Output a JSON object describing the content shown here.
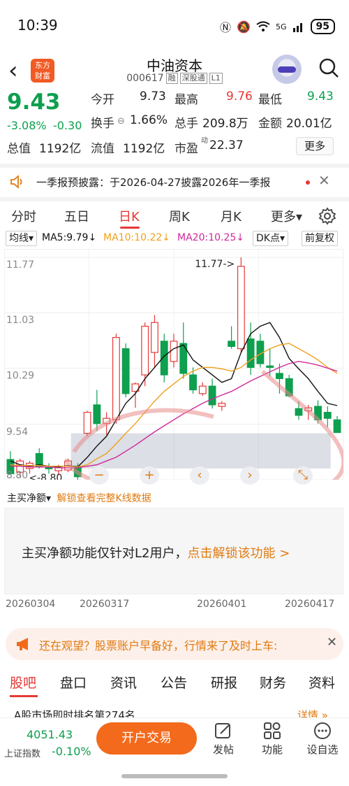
{
  "status": {
    "time": "10:39",
    "network": "5G",
    "battery": "95"
  },
  "header": {
    "logo_text_1": "东方",
    "logo_text_2": "财富",
    "stock_name": "中油资本",
    "stock_code": "000617",
    "tags": [
      "融",
      "深股通",
      "L1"
    ]
  },
  "quote": {
    "price": "9.43",
    "change_pct": "-3.08%",
    "change_abs": "-0.30",
    "open_label": "今开",
    "open_value": "9.73",
    "high_label": "最高",
    "high_value": "9.76",
    "low_label": "最低",
    "low_value": "9.43",
    "turnover_label": "换手",
    "turnover_value": "1.66%",
    "volume_label": "总手",
    "volume_value": "209.8万",
    "amount_label": "金额",
    "amount_value": "20.01亿",
    "mcap_label": "总值",
    "mcap_value": "1192亿",
    "float_label": "流值",
    "float_value": "1192亿",
    "pe_label": "市盈",
    "pe_sup": "动",
    "pe_value": "22.37",
    "more_label": "更多"
  },
  "notice": {
    "text": "一季报预披露：于2026-04-27披露2026年一季报"
  },
  "period_tabs": [
    "分时",
    "五日",
    "日K",
    "周K",
    "月K",
    "更多▾"
  ],
  "indicators": {
    "main": "均线▾",
    "ma5": "MA5:9.79↓",
    "ma10": "MA10:10.22↓",
    "ma20": "MA20:10.25↓",
    "dk": "DK点▾",
    "adjust": "前复权"
  },
  "colors": {
    "up": "#e53935",
    "down": "#0e9f4f",
    "ma5": "#111111",
    "ma10": "#f0a020",
    "ma20": "#d0289a",
    "accent": "#f36a1c"
  },
  "chart_data": {
    "type": "candlestick",
    "y_ticks": [
      "11.77",
      "11.03",
      "10.29",
      "9.54",
      "8.80"
    ],
    "ylim": [
      8.8,
      11.77
    ],
    "high_marker": "11.77->",
    "low_marker": "<-8.80",
    "x_labels": [
      "20260304",
      "20260317",
      "20260401",
      "20260417"
    ],
    "candles": [
      {
        "o": 9.07,
        "h": 9.18,
        "l": 8.86,
        "c": 8.88
      },
      {
        "o": 8.9,
        "h": 9.08,
        "l": 8.84,
        "c": 9.05
      },
      {
        "o": 8.95,
        "h": 9.05,
        "l": 8.88,
        "c": 9.02
      },
      {
        "o": 9.15,
        "h": 9.22,
        "l": 8.95,
        "c": 8.97
      },
      {
        "o": 8.96,
        "h": 9.02,
        "l": 8.88,
        "c": 8.95
      },
      {
        "o": 8.92,
        "h": 9.0,
        "l": 8.86,
        "c": 8.96
      },
      {
        "o": 8.93,
        "h": 9.08,
        "l": 8.9,
        "c": 9.05
      },
      {
        "o": 8.98,
        "h": 9.02,
        "l": 8.8,
        "c": 8.84
      },
      {
        "o": 9.42,
        "h": 9.72,
        "l": 9.38,
        "c": 9.7
      },
      {
        "o": 9.8,
        "h": 10.0,
        "l": 9.45,
        "c": 9.55
      },
      {
        "o": 9.55,
        "h": 9.7,
        "l": 9.4,
        "c": 9.62
      },
      {
        "o": 9.6,
        "h": 10.75,
        "l": 9.55,
        "c": 10.7
      },
      {
        "o": 10.55,
        "h": 10.62,
        "l": 9.9,
        "c": 9.95
      },
      {
        "o": 9.98,
        "h": 10.1,
        "l": 9.76,
        "c": 10.08
      },
      {
        "o": 10.2,
        "h": 10.9,
        "l": 10.05,
        "c": 10.85
      },
      {
        "o": 10.5,
        "h": 11.0,
        "l": 10.3,
        "c": 10.9
      },
      {
        "o": 10.65,
        "h": 10.75,
        "l": 10.1,
        "c": 10.2
      },
      {
        "o": 10.38,
        "h": 10.75,
        "l": 10.3,
        "c": 10.65
      },
      {
        "o": 10.62,
        "h": 10.9,
        "l": 10.15,
        "c": 10.22
      },
      {
        "o": 10.2,
        "h": 10.3,
        "l": 9.95,
        "c": 10.0
      },
      {
        "o": 9.95,
        "h": 10.1,
        "l": 9.92,
        "c": 10.05
      },
      {
        "o": 10.05,
        "h": 10.15,
        "l": 9.75,
        "c": 9.8
      },
      {
        "o": 9.78,
        "h": 9.85,
        "l": 9.72,
        "c": 9.82
      },
      {
        "o": 10.65,
        "h": 10.85,
        "l": 10.55,
        "c": 10.58
      },
      {
        "o": 10.55,
        "h": 11.77,
        "l": 10.5,
        "c": 11.65
      },
      {
        "o": 10.68,
        "h": 10.9,
        "l": 10.2,
        "c": 10.3
      },
      {
        "o": 10.65,
        "h": 10.75,
        "l": 10.3,
        "c": 10.35
      },
      {
        "o": 10.32,
        "h": 10.55,
        "l": 10.18,
        "c": 10.3
      },
      {
        "o": 10.22,
        "h": 10.35,
        "l": 9.95,
        "c": 10.15
      },
      {
        "o": 10.15,
        "h": 10.2,
        "l": 9.9,
        "c": 9.92
      },
      {
        "o": 9.75,
        "h": 9.85,
        "l": 9.6,
        "c": 9.66
      },
      {
        "o": 9.72,
        "h": 9.8,
        "l": 9.6,
        "c": 9.76
      },
      {
        "o": 9.78,
        "h": 9.86,
        "l": 9.55,
        "c": 9.6
      },
      {
        "o": 9.7,
        "h": 9.78,
        "l": 9.5,
        "c": 9.62
      },
      {
        "o": 9.6,
        "h": 9.65,
        "l": 9.43,
        "c": 9.43
      }
    ],
    "ma5": [
      9.05,
      9.0,
      8.98,
      9.0,
      8.98,
      8.97,
      8.99,
      8.97,
      9.1,
      9.25,
      9.38,
      9.6,
      9.82,
      9.95,
      10.15,
      10.3,
      10.45,
      10.55,
      10.6,
      10.4,
      10.3,
      10.2,
      10.1,
      10.15,
      10.5,
      10.75,
      10.85,
      10.9,
      10.7,
      10.42,
      10.28,
      10.15,
      9.98,
      9.82,
      9.79
    ],
    "ma10": [
      9.0,
      8.99,
      8.99,
      8.99,
      8.98,
      8.98,
      8.98,
      8.97,
      9.0,
      9.08,
      9.15,
      9.28,
      9.42,
      9.55,
      9.7,
      9.85,
      9.98,
      10.08,
      10.18,
      10.25,
      10.3,
      10.3,
      10.28,
      10.25,
      10.3,
      10.4,
      10.48,
      10.55,
      10.6,
      10.62,
      10.55,
      10.48,
      10.4,
      10.3,
      10.22
    ],
    "ma20": [
      8.98,
      8.98,
      8.97,
      8.97,
      8.97,
      8.96,
      8.96,
      8.96,
      8.98,
      9.0,
      9.05,
      9.1,
      9.18,
      9.26,
      9.35,
      9.44,
      9.52,
      9.6,
      9.68,
      9.75,
      9.82,
      9.88,
      9.93,
      9.98,
      10.05,
      10.12,
      10.18,
      10.24,
      10.3,
      10.35,
      10.38,
      10.36,
      10.33,
      10.29,
      10.25
    ]
  },
  "zoom_controls": [
    "−",
    "+",
    "‹",
    "›",
    "⤡"
  ],
  "sub_indicator": {
    "label": "主买净额▾",
    "unlock": "解锁查看完整K线数据"
  },
  "lock_panel": {
    "text": "主买净额功能仅针对L2用户，",
    "link": "点击解锁该功能 >"
  },
  "promo": {
    "text": "还在观望？股票账户早备好，行情来了及时上车:"
  },
  "content_tabs": [
    "股吧",
    "盘口",
    "资讯",
    "公告",
    "研报",
    "财务",
    "资料"
  ],
  "ticker_line": "A股市场即时排名第274名",
  "ticker_right": "详情 »",
  "bottom": {
    "index_value": "4051.43",
    "index_name": "上证指数",
    "index_pct": "-0.10%",
    "trade_label": "开户交易",
    "nav": [
      "发帖",
      "功能",
      "设自选"
    ]
  }
}
